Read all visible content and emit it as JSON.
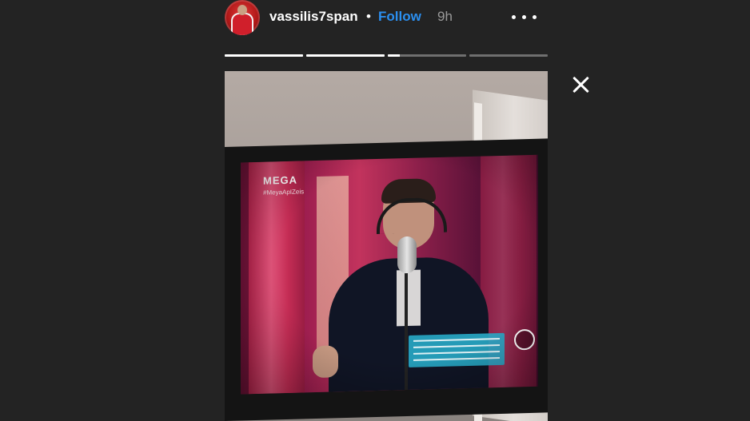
{
  "header": {
    "username": "vassilis7span",
    "separator": "•",
    "follow_label": "Follow",
    "time_ago": "9h",
    "more_icon": "more-horizontal-icon"
  },
  "progress": {
    "segments": [
      1,
      1,
      0.15,
      0
    ]
  },
  "close_icon": "close-icon",
  "media": {
    "tv_channel_logo": "MEGA",
    "tv_channel_sub": "#MeyaApIZeis"
  },
  "colors": {
    "background": "#232323",
    "follow_link": "#2b8ff0",
    "time_text": "#9a9a9a"
  }
}
